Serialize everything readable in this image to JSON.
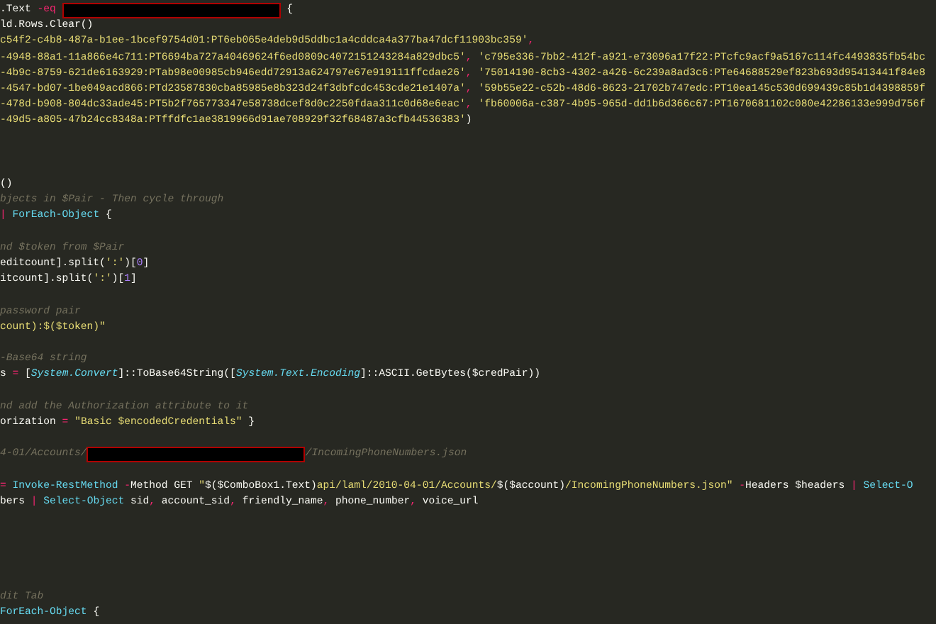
{
  "editor": {
    "lines": [
      {
        "kind": "code",
        "tokens": [
          {
            "kind": "plain",
            "text": ".Text "
          },
          {
            "kind": "operator",
            "text": "-eq "
          },
          {
            "kind": "redaction"
          },
          {
            "kind": "plain",
            "text": " {"
          }
        ]
      },
      {
        "kind": "code",
        "tokens": [
          {
            "kind": "plain",
            "text": "ld.Rows.Clear()"
          }
        ]
      },
      {
        "kind": "code",
        "tokens": [
          {
            "kind": "string",
            "text": "c54f2-c4b8-487a-b1ee-1bcef9754d01:PT6eb065e4deb9d5ddbc1a4cddca4a377ba47dcf11903bc359'"
          },
          {
            "kind": "operator",
            "text": ","
          }
        ]
      },
      {
        "kind": "code",
        "tokens": [
          {
            "kind": "string",
            "text": "-4948-88a1-11a866e4c711:PT6694ba727a40469624f6ed0809c4072151243284a829dbc5'"
          },
          {
            "kind": "operator",
            "text": ", "
          },
          {
            "kind": "string",
            "text": "'c795e336-7bb2-412f-a921-e73096a17f22:PTcfc9acf9a5167c114fc4493835fb54bc"
          }
        ]
      },
      {
        "kind": "code",
        "tokens": [
          {
            "kind": "string",
            "text": "-4b9c-8759-621de6163929:PTab98e00985cb946edd72913a624797e67e919111ffcdae26'"
          },
          {
            "kind": "operator",
            "text": ", "
          },
          {
            "kind": "string",
            "text": "'75014190-8cb3-4302-a426-6c239a8ad3c6:PTe64688529ef823b693d95413441f84e8"
          }
        ]
      },
      {
        "kind": "code",
        "tokens": [
          {
            "kind": "string",
            "text": "-4547-bd07-1be049acd866:PTd23587830cba85985e8b323d24f3dbfcdc453cde21e1407a'"
          },
          {
            "kind": "operator",
            "text": ", "
          },
          {
            "kind": "string",
            "text": "'59b55e22-c52b-48d6-8623-21702b747edc:PT10ea145c530d699439c85b1d4398859f"
          }
        ]
      },
      {
        "kind": "code",
        "tokens": [
          {
            "kind": "string",
            "text": "-478d-b908-804dc33ade45:PT5b2f765773347e58738dcef8d0c2250fdaa311c0d68e6eac'"
          },
          {
            "kind": "operator",
            "text": ", "
          },
          {
            "kind": "string",
            "text": "'fb60006a-c387-4b95-965d-dd1b6d366c67:PT1670681102c080e42286133e999d756f"
          }
        ]
      },
      {
        "kind": "code",
        "tokens": [
          {
            "kind": "string",
            "text": "-49d5-a805-47b24cc8348a:PTffdfc1ae3819966d91ae708929f32f68487a3cfb44536383'"
          },
          {
            "kind": "plain",
            "text": ")"
          }
        ]
      },
      {
        "kind": "blank"
      },
      {
        "kind": "blank"
      },
      {
        "kind": "blank"
      },
      {
        "kind": "code",
        "tokens": [
          {
            "kind": "plain",
            "text": "()"
          }
        ]
      },
      {
        "kind": "code",
        "tokens": [
          {
            "kind": "comment",
            "text": "bjects in $Pair - Then cycle through"
          }
        ]
      },
      {
        "kind": "code",
        "tokens": [
          {
            "kind": "operator",
            "text": "| "
          },
          {
            "kind": "function",
            "text": "ForEach-Object"
          },
          {
            "kind": "plain",
            "text": " {"
          }
        ]
      },
      {
        "kind": "blank"
      },
      {
        "kind": "code",
        "tokens": [
          {
            "kind": "comment",
            "text": "nd $token from $Pair"
          }
        ]
      },
      {
        "kind": "code",
        "tokens": [
          {
            "kind": "plain",
            "text": "editcount].split("
          },
          {
            "kind": "string",
            "text": "':'"
          },
          {
            "kind": "plain",
            "text": ")["
          },
          {
            "kind": "number",
            "text": "0"
          },
          {
            "kind": "plain",
            "text": "]"
          }
        ]
      },
      {
        "kind": "code",
        "tokens": [
          {
            "kind": "plain",
            "text": "itcount].split("
          },
          {
            "kind": "string",
            "text": "':'"
          },
          {
            "kind": "plain",
            "text": ")["
          },
          {
            "kind": "number",
            "text": "1"
          },
          {
            "kind": "plain",
            "text": "]"
          }
        ]
      },
      {
        "kind": "blank"
      },
      {
        "kind": "code",
        "tokens": [
          {
            "kind": "comment",
            "text": "password pair"
          }
        ]
      },
      {
        "kind": "code",
        "tokens": [
          {
            "kind": "string",
            "text": "count):$($token)\""
          }
        ]
      },
      {
        "kind": "blank"
      },
      {
        "kind": "code",
        "tokens": [
          {
            "kind": "comment",
            "text": "-Base64 string"
          }
        ]
      },
      {
        "kind": "code",
        "tokens": [
          {
            "kind": "plain",
            "text": "s "
          },
          {
            "kind": "operator",
            "text": "="
          },
          {
            "kind": "plain",
            "text": " ["
          },
          {
            "kind": "type",
            "text": "System.Convert"
          },
          {
            "kind": "plain",
            "text": "]::ToBase64String(["
          },
          {
            "kind": "type",
            "text": "System.Text.Encoding"
          },
          {
            "kind": "plain",
            "text": "]::ASCII.GetBytes($credPair))"
          }
        ]
      },
      {
        "kind": "blank"
      },
      {
        "kind": "code",
        "tokens": [
          {
            "kind": "comment",
            "text": "nd add the Authorization attribute to it"
          }
        ]
      },
      {
        "kind": "code",
        "tokens": [
          {
            "kind": "plain",
            "text": "orization "
          },
          {
            "kind": "operator",
            "text": "= "
          },
          {
            "kind": "string",
            "text": "\"Basic $encodedCredentials\""
          },
          {
            "kind": "plain",
            "text": " }"
          }
        ]
      },
      {
        "kind": "blank"
      },
      {
        "kind": "code",
        "tokens": [
          {
            "kind": "comment",
            "text": "4-01/Accounts/"
          },
          {
            "kind": "redaction"
          },
          {
            "kind": "comment",
            "text": "/IncomingPhoneNumbers.json"
          }
        ]
      },
      {
        "kind": "blank"
      },
      {
        "kind": "code",
        "tokens": [
          {
            "kind": "operator",
            "text": "= "
          },
          {
            "kind": "function",
            "text": "Invoke-RestMethod "
          },
          {
            "kind": "operator",
            "text": "-"
          },
          {
            "kind": "plain",
            "text": "Method GET "
          },
          {
            "kind": "string",
            "text": "\""
          },
          {
            "kind": "plain",
            "text": "$($ComboBox1.Text)"
          },
          {
            "kind": "string",
            "text": "api/laml/2010-04-01/Accounts/"
          },
          {
            "kind": "plain",
            "text": "$($account)"
          },
          {
            "kind": "string",
            "text": "/IncomingPhoneNumbers.json\" "
          },
          {
            "kind": "operator",
            "text": "-"
          },
          {
            "kind": "plain",
            "text": "Headers $headers "
          },
          {
            "kind": "operator",
            "text": "| "
          },
          {
            "kind": "function",
            "text": "Select-O"
          }
        ]
      },
      {
        "kind": "code",
        "tokens": [
          {
            "kind": "plain",
            "text": "bers "
          },
          {
            "kind": "operator",
            "text": "| "
          },
          {
            "kind": "function",
            "text": "Select-Object"
          },
          {
            "kind": "plain",
            "text": " sid"
          },
          {
            "kind": "operator",
            "text": ","
          },
          {
            "kind": "plain",
            "text": " account_sid"
          },
          {
            "kind": "operator",
            "text": ","
          },
          {
            "kind": "plain",
            "text": " friendly_name"
          },
          {
            "kind": "operator",
            "text": ","
          },
          {
            "kind": "plain",
            "text": " phone_number"
          },
          {
            "kind": "operator",
            "text": ","
          },
          {
            "kind": "plain",
            "text": " voice_url"
          }
        ]
      },
      {
        "kind": "blank"
      },
      {
        "kind": "blank"
      },
      {
        "kind": "blank"
      },
      {
        "kind": "blank"
      },
      {
        "kind": "blank"
      },
      {
        "kind": "code",
        "tokens": [
          {
            "kind": "comment",
            "text": "dit Tab"
          }
        ]
      },
      {
        "kind": "code",
        "tokens": [
          {
            "kind": "function",
            "text": "ForEach-Object"
          },
          {
            "kind": "plain",
            "text": " {"
          }
        ]
      }
    ]
  }
}
